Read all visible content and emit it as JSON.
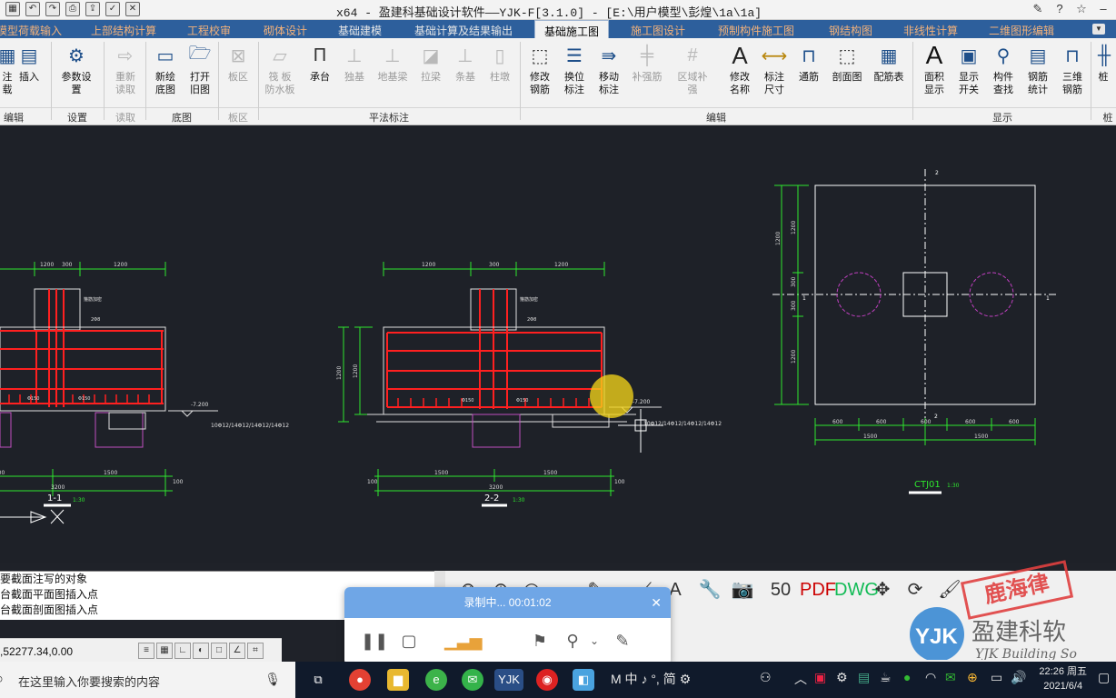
{
  "window": {
    "title": "x64 - 盈建科基础设计软件——YJK-F[3.1.0] - [E:\\用户模型\\彭煌\\1a\\1a]"
  },
  "tabs": [
    {
      "label": "模型荷载输入",
      "active": false
    },
    {
      "label": "上部结构计算",
      "active": false
    },
    {
      "label": "工程校审",
      "active": false
    },
    {
      "label": "砌体设计",
      "active": false
    },
    {
      "label": "基础建模",
      "active": false
    },
    {
      "label": "基础计算及结果输出",
      "active": false
    },
    {
      "label": "基础施工图",
      "active": true
    },
    {
      "label": "施工图设计",
      "active": false
    },
    {
      "label": "预制构件施工图",
      "active": false
    },
    {
      "label": "钢结构图",
      "active": false
    },
    {
      "label": "非线性计算",
      "active": false
    },
    {
      "label": "二维图形编辑",
      "active": false
    }
  ],
  "ribbon": {
    "buttons": [
      {
        "label": "注\n载",
        "icon": "grid-icon",
        "disabled": false
      },
      {
        "label": "插入",
        "icon": "insert-table-icon",
        "disabled": false
      },
      {
        "label": "参数设置",
        "icon": "settings-icon",
        "disabled": false
      },
      {
        "label": "重新\n读取",
        "icon": "reload-icon",
        "disabled": true
      },
      {
        "label": "新绘\n底图",
        "icon": "new-page-icon",
        "disabled": false
      },
      {
        "label": "打开\n旧图",
        "icon": "folder-icon",
        "disabled": false
      },
      {
        "label": "板区",
        "icon": "slab-icon",
        "disabled": true
      },
      {
        "label": "筏 板\n防水板",
        "icon": "raft-icon",
        "disabled": true
      },
      {
        "label": "承台",
        "icon": "pile-cap-icon",
        "disabled": false
      },
      {
        "label": "独基",
        "icon": "footing-icon",
        "disabled": true
      },
      {
        "label": "地基梁",
        "icon": "ground-beam-icon",
        "disabled": true
      },
      {
        "label": "拉梁",
        "icon": "tie-beam-icon",
        "disabled": true
      },
      {
        "label": "条基",
        "icon": "strip-footing-icon",
        "disabled": true
      },
      {
        "label": "柱墩",
        "icon": "column-pier-icon",
        "disabled": true
      },
      {
        "label": "修改\n钢筋",
        "icon": "edit-rebar-icon",
        "disabled": false
      },
      {
        "label": "换位\n标注",
        "icon": "swap-label-icon",
        "disabled": false
      },
      {
        "label": "移动\n标注",
        "icon": "move-label-icon",
        "disabled": false
      },
      {
        "label": "补强筋",
        "icon": "reinforce-icon",
        "disabled": true
      },
      {
        "label": "区域补强",
        "icon": "area-reinforce-icon",
        "disabled": true
      },
      {
        "label": "修改\n名称",
        "icon": "rename-icon",
        "disabled": false
      },
      {
        "label": "标注\n尺寸",
        "icon": "dimension-icon",
        "disabled": false
      },
      {
        "label": "通筋",
        "icon": "through-bar-icon",
        "disabled": false
      },
      {
        "label": "剖面图",
        "icon": "section-icon",
        "disabled": false
      },
      {
        "label": "配筋表",
        "icon": "rebar-table-icon",
        "disabled": false
      },
      {
        "label": "面积\n显示",
        "icon": "area-text-icon",
        "disabled": false
      },
      {
        "label": "显示\n开关",
        "icon": "display-toggle-icon",
        "disabled": false
      },
      {
        "label": "构件\n查找",
        "icon": "find-icon",
        "disabled": false
      },
      {
        "label": "钢筋\n统计",
        "icon": "rebar-stats-icon",
        "disabled": false
      },
      {
        "label": "三维\n钢筋",
        "icon": "3d-rebar-icon",
        "disabled": false
      },
      {
        "label": "桩",
        "icon": "pile-icon",
        "disabled": false
      }
    ],
    "groups": [
      {
        "label": "编辑",
        "disabled": false
      },
      {
        "label": "设置",
        "disabled": false
      },
      {
        "label": "读取",
        "disabled": true
      },
      {
        "label": "底图",
        "disabled": false
      },
      {
        "label": "板区",
        "disabled": true
      },
      {
        "label": "平法标注",
        "disabled": false
      },
      {
        "label": "编辑",
        "disabled": false
      },
      {
        "label": "显示",
        "disabled": false
      },
      {
        "label": "桩",
        "disabled": false
      }
    ]
  },
  "drawing": {
    "section1": {
      "name": "1-1",
      "scale": "1:30",
      "top_dims": [
        "1200",
        "300",
        "1200"
      ],
      "bottom_dims": [
        "1500",
        "1500"
      ],
      "total": "3200",
      "side": "100",
      "elev": "-7.200",
      "bar_spec": "10Φ12/14Φ12/14Φ12/14Φ12",
      "note1": "箍筋加密",
      "note2": "2Φ8",
      "rebar1": "Φ150",
      "rebar2": "Φ150"
    },
    "section2": {
      "name": "2-2",
      "scale": "1:30",
      "top_dims": [
        "1200",
        "300",
        "1200"
      ],
      "bottom_dims": [
        "1500",
        "1500"
      ],
      "total": "3200",
      "side": "100",
      "elev": "-7.200",
      "bar_spec": "10Φ12/14Φ12/14Φ12/14Φ12",
      "height_outer": "1200",
      "height_inner": "1200",
      "note1": "箍筋加密",
      "note2": "2Φ8",
      "rebar1": "Φ150",
      "rebar2": "Φ150"
    },
    "plan": {
      "name": "CTJ01",
      "scale": "1:30",
      "left_dims": [
        "1200",
        "300",
        "300",
        "1200"
      ],
      "bottom_dims": [
        "600",
        "600",
        "600",
        "600",
        "600"
      ],
      "bottom_dims2": [
        "1500",
        "1500"
      ],
      "axis_top": "2",
      "axis_right": "1",
      "axis_left": "1",
      "axis_bottom": "2"
    }
  },
  "command_lines": [
    "要截面注写的对象",
    "台截面平面图插入点",
    "台截面剖面图插入点"
  ],
  "coords": ",52277.34,0.00",
  "recorder": {
    "status": "录制中... 00:01:02",
    "close_icon": "close-icon"
  },
  "logo": {
    "company": "盈建科软",
    "brand": "YJK",
    "english": "YJK Building So",
    "stamp": "鹿海律"
  },
  "taskbar": {
    "search_placeholder": "在这里输入你要搜索的内容",
    "ime": "M 中 ♪ °, 简 ⚙",
    "time": "22:26 周五",
    "date": "2021/6/4"
  },
  "colors": {
    "accent": "#2d5f9c",
    "canvas": "#1e2128",
    "rebar": "#ff2020",
    "dim": "#2ee62e",
    "recorder": "#6fa6e6"
  }
}
